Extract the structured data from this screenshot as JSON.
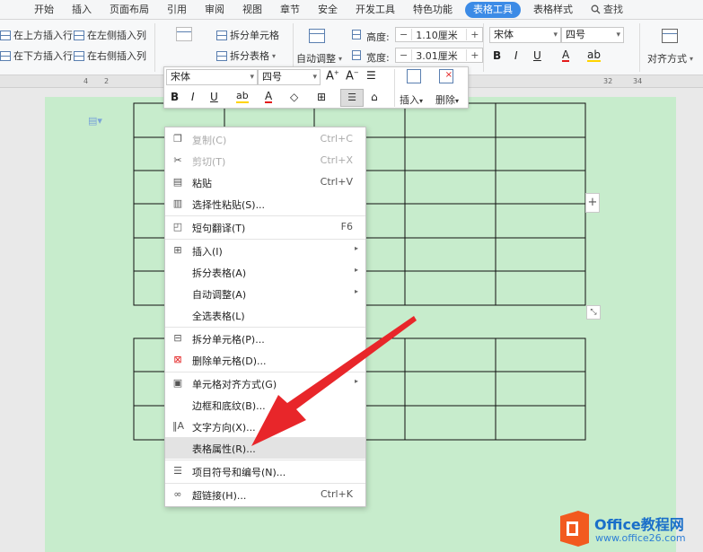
{
  "tabs": [
    "开始",
    "插入",
    "页面布局",
    "引用",
    "审阅",
    "视图",
    "章节",
    "安全",
    "开发工具",
    "特色功能",
    "表格工具",
    "表格样式",
    "查找"
  ],
  "ribbon": {
    "insert_above": "在上方插入行",
    "insert_left": "在左侧插入列",
    "insert_below": "在下方插入行",
    "insert_right": "在右侧插入列",
    "merge_cells": "合并单元格",
    "split_cells": "拆分单元格",
    "split_table": "拆分表格",
    "auto_adjust": "自动调整",
    "height_label": "高度:",
    "height_value": "1.10厘米",
    "width_label": "宽度:",
    "width_value": "3.01厘米",
    "font_name": "宋体",
    "font_size": "四号",
    "align": "对齐方式"
  },
  "ruler": [
    "4",
    "2",
    "32",
    "34"
  ],
  "floatbar": {
    "font_name": "宋体",
    "font_size": "四号",
    "insert": "插入",
    "delete": "删除"
  },
  "menu": [
    {
      "label": "复制(C)",
      "shortcut": "Ctrl+C",
      "disabled": true
    },
    {
      "label": "剪切(T)",
      "shortcut": "Ctrl+X",
      "disabled": true
    },
    {
      "label": "粘贴",
      "shortcut": "Ctrl+V",
      "disabled": false
    },
    {
      "label": "选择性粘贴(S)...",
      "shortcut": "",
      "disabled": false
    },
    {
      "label": "短句翻译(T)",
      "shortcut": "F6",
      "disabled": false
    },
    {
      "label": "插入(I)",
      "shortcut": "",
      "disabled": false
    },
    {
      "label": "拆分表格(A)",
      "shortcut": "",
      "disabled": false
    },
    {
      "label": "自动调整(A)",
      "shortcut": "",
      "disabled": false
    },
    {
      "label": "全选表格(L)",
      "shortcut": "",
      "disabled": false
    },
    {
      "label": "拆分单元格(P)...",
      "shortcut": "",
      "disabled": false
    },
    {
      "label": "删除单元格(D)...",
      "shortcut": "",
      "disabled": false
    },
    {
      "label": "单元格对齐方式(G)",
      "shortcut": "",
      "disabled": false
    },
    {
      "label": "边框和底纹(B)...",
      "shortcut": "",
      "disabled": false
    },
    {
      "label": "文字方向(X)...",
      "shortcut": "",
      "disabled": false
    },
    {
      "label": "表格属性(R)...",
      "shortcut": "",
      "disabled": false
    },
    {
      "label": "项目符号和编号(N)...",
      "shortcut": "",
      "disabled": false
    },
    {
      "label": "超链接(H)...",
      "shortcut": "Ctrl+K",
      "disabled": false
    }
  ],
  "watermark": {
    "brand": "Office教程网",
    "url": "www.office26.com"
  },
  "colors": {
    "page": "#c7eccc",
    "accent": "#3c8be6",
    "arrow": "#e8262a",
    "logo": "#f25a1f"
  }
}
